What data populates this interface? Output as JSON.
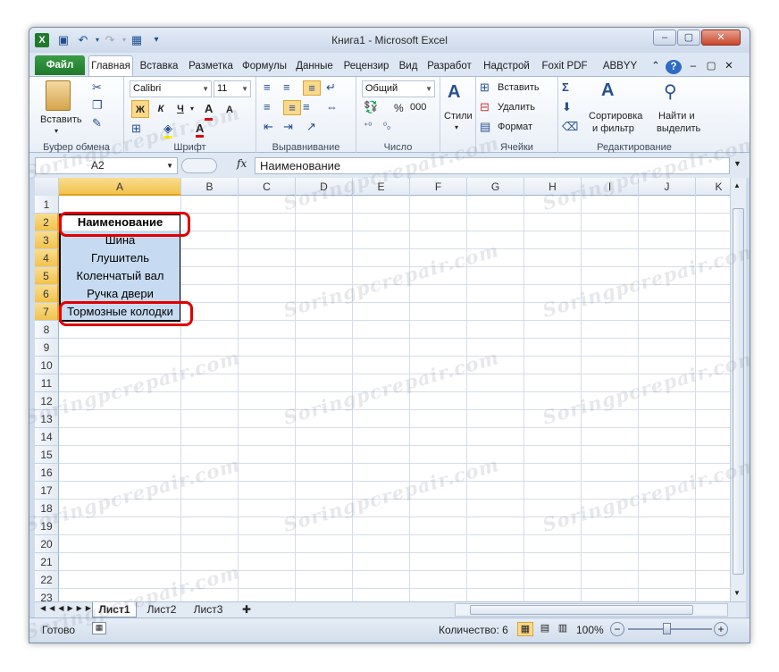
{
  "window": {
    "title": "Книга1 - Microsoft Excel",
    "controls": {
      "minimize": "–",
      "maximize": "▢",
      "close": "✕"
    }
  },
  "ribbon_tabs": [
    "Файл",
    "Главная",
    "Вставка",
    "Разметка",
    "Формулы",
    "Данные",
    "Рецензир",
    "Вид",
    "Разработ",
    "Надстрой",
    "Foxit PDF",
    "ABBYY PDI"
  ],
  "active_tab": "Главная",
  "ribbon": {
    "clipboard": {
      "paste": "Вставить",
      "label": "Буфер обмена"
    },
    "font": {
      "name": "Calibri",
      "size": "11",
      "bold": "Ж",
      "italic": "К",
      "underline": "Ч",
      "label": "Шрифт"
    },
    "alignment": {
      "label": "Выравнивание"
    },
    "number": {
      "format": "Общий",
      "label": "Число",
      "percent": "%",
      "thousands": "000"
    },
    "styles": {
      "label": "Стили"
    },
    "cells": {
      "insert": "Вставить",
      "delete": "Удалить",
      "format": "Формат",
      "label": "Ячейки"
    },
    "editing": {
      "sort": "Сортировка",
      "sort2": "и фильтр",
      "find": "Найти и",
      "find2": "выделить",
      "label": "Редактирование"
    }
  },
  "formula_bar": {
    "name_box": "A2",
    "fx": "fx",
    "content": "Наименование"
  },
  "columns": [
    "A",
    "B",
    "C",
    "D",
    "E",
    "F",
    "G",
    "H",
    "I",
    "J",
    "K"
  ],
  "rows": [
    "1",
    "2",
    "3",
    "4",
    "5",
    "6",
    "7",
    "8",
    "9",
    "10",
    "11",
    "12",
    "13",
    "14",
    "15",
    "16",
    "17",
    "18",
    "19",
    "20",
    "21",
    "22",
    "23"
  ],
  "cells": {
    "A2": "Наименование",
    "A3": "Шина",
    "A4": "Глушитель",
    "A5": "Коленчатый вал",
    "A6": "Ручка двери",
    "A7": "Тормозные колодки"
  },
  "sheets": [
    "Лист1",
    "Лист2",
    "Лист3"
  ],
  "active_sheet": "Лист1",
  "status": {
    "ready": "Готово",
    "count": "Количество: 6",
    "zoom": "100%"
  },
  "watermark": "Soringpcrepair.com"
}
